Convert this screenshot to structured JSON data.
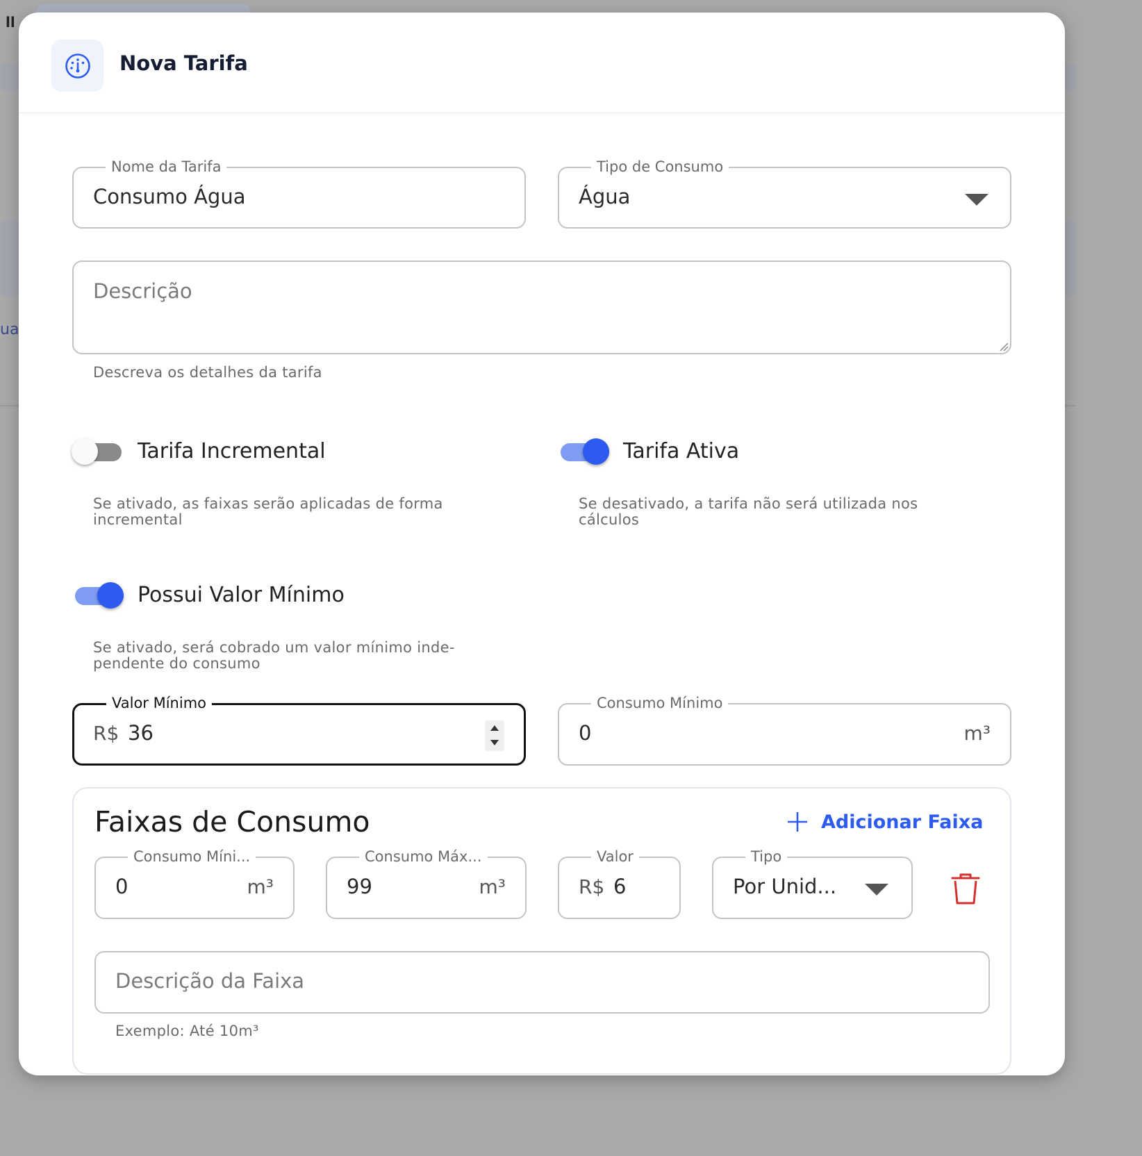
{
  "background": {
    "handle": "ll",
    "fragment": "ua"
  },
  "dialog": {
    "title": "Nova Tarifa",
    "icon": "gauge-icon"
  },
  "form": {
    "nome": {
      "label": "Nome da Tarifa",
      "value": "Consumo Água"
    },
    "tipo_consumo": {
      "label": "Tipo de Consumo",
      "value": "Água"
    },
    "descricao": {
      "placeholder": "Descrição",
      "helper": "Descreva os detalhes da tarifa"
    },
    "tarifa_incremental": {
      "label": "Tarifa Incremental",
      "checked": false,
      "helper_line1": "Se ativado, as faixas serão aplicadas de forma",
      "helper_line2": "incremental"
    },
    "tarifa_ativa": {
      "label": "Tarifa Ativa",
      "checked": true,
      "helper_line1": "Se desativado, a tarifa não será utilizada nos",
      "helper_line2": "cálculos"
    },
    "possui_valor_minimo": {
      "label": "Possui Valor Mínimo",
      "checked": true,
      "helper_line1": "Se ativado, será cobrado um valor mínimo inde-",
      "helper_line2": "pendente do consumo"
    },
    "valor_minimo": {
      "label": "Valor Mínimo",
      "prefix": "R$",
      "value": "36"
    },
    "consumo_minimo": {
      "label": "Consumo Mínimo",
      "value": "0",
      "suffix": "m³"
    }
  },
  "faixas": {
    "title": "Faixas de Consumo",
    "add_label": "Adicionar Faixa",
    "rows": [
      {
        "consumo_min": {
          "label": "Consumo Míni...",
          "value": "0",
          "suffix": "m³"
        },
        "consumo_max": {
          "label": "Consumo Máx...",
          "value": "99",
          "suffix": "m³"
        },
        "valor": {
          "label": "Valor",
          "prefix": "R$",
          "value": "6"
        },
        "tipo": {
          "label": "Tipo",
          "value": "Por Unid..."
        },
        "descricao": {
          "placeholder": "Descrição da Faixa",
          "helper": "Exemplo: Até 10m³"
        }
      }
    ]
  },
  "colors": {
    "accent": "#2d5bef",
    "danger": "#d32f2f",
    "title": "#141d33"
  }
}
